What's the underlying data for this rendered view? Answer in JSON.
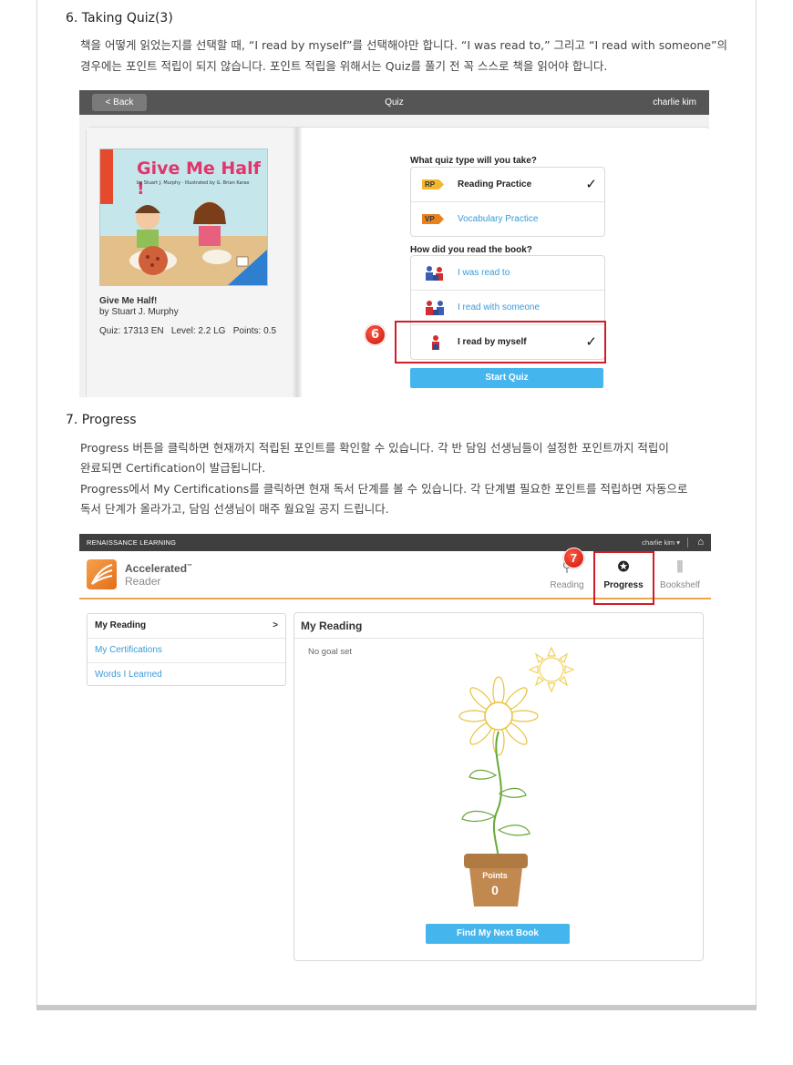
{
  "section6": {
    "heading": "6. Taking Quiz(3)",
    "para_line1": "책을 어떻게 읽었는지를 선택할 때, “I read by myself”를 선택해야만 합니다. “I was read to,” 그리고 “I read with someone”의",
    "para_line2": "경우에는 포인트 적립이 되지 않습니다. 포인트 적립을 위해서는  Quiz를 풀기 전 꼭 스스로 책을 읽어야 합니다."
  },
  "quiz_screen": {
    "back_label": "< Back",
    "title": "Quiz",
    "user": "charlie kim",
    "book": {
      "cover_title": "Give Me Half !",
      "cover_byline": "by Stuart J. Murphy · Illustrated by G. Brian Karas",
      "title": "Give Me Half!",
      "author": "by Stuart J. Murphy",
      "quiz_info": "Quiz: 17313 EN   Level: 2.2 LG   Points: 0.5"
    },
    "quiz_type_heading": "What quiz type will you take?",
    "quiz_types": [
      {
        "badge": "RP",
        "label": "Reading Practice",
        "selected": true
      },
      {
        "badge": "VP",
        "label": "Vocabulary Practice",
        "selected": false
      }
    ],
    "read_heading": "How did you read the book?",
    "read_options": [
      {
        "label": "I was read to",
        "selected": false
      },
      {
        "label": "I read with someone",
        "selected": false
      },
      {
        "label": "I read by myself",
        "selected": true
      }
    ],
    "check_glyph": "✓",
    "marker": "6",
    "start_button": "Start Quiz"
  },
  "section7": {
    "heading": "7. Progress",
    "para_line1": "Progress 버튼을 클릭하면 현재까지 적립된 포인트를 확인할 수 있습니다. 각 반 담임 선생님들이 설정한 포인트까지 적립이",
    "para_line2": "완료되면 Certification이 발급됩니다.",
    "para_line3": "Progress에서 My Certifications를 클릭하면 현재 독서 단계를 볼 수 있습니다. 각 단계별 필요한 포인트를 적립하면 자동으로",
    "para_line4": "독서 단계가 올라가고, 담임 선생님이 매주 월요일 공지 드립니다."
  },
  "progress_screen": {
    "brand": "RENAISSANCE LEARNING",
    "user": "charlie kim ▾",
    "home_icon": "⌂",
    "app_name": "Accelerated",
    "app_tm": "™",
    "app_sub": "Reader",
    "nav": [
      {
        "label": "Reading",
        "icon": "search-icon",
        "glyph": "⚲"
      },
      {
        "label": "Progress",
        "icon": "star-circle-icon",
        "glyph": "✪"
      },
      {
        "label": "Bookshelf",
        "icon": "books-icon",
        "glyph": "⫼"
      }
    ],
    "marker": "7",
    "sidebar": [
      {
        "label": "My Reading",
        "active": true,
        "arrow": ">"
      },
      {
        "label": "My Certifications",
        "active": false
      },
      {
        "label": "Words I Learned",
        "active": false
      }
    ],
    "panel_title": "My Reading",
    "goal_text": "No goal set",
    "pot_label": "Points",
    "points_value": "0",
    "find_button": "Find My Next Book",
    "colors": {
      "accent_orange": "#f0a54a",
      "button_blue": "#45b5ee",
      "marker_red": "#d01d2a",
      "link_blue": "#3a9ad9"
    }
  }
}
